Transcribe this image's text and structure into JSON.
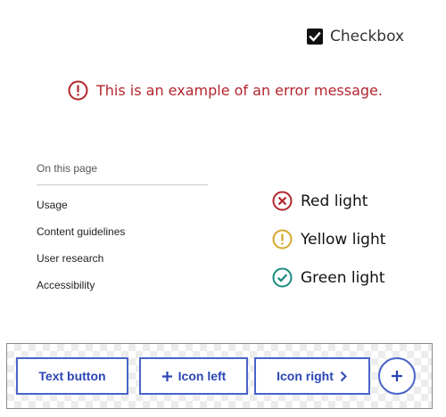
{
  "checkbox": {
    "label": "Checkbox",
    "checked": true,
    "icon": "checkmark-icon"
  },
  "error": {
    "message": "This is an example of an error message.",
    "icon": "error-circle-icon",
    "color": "#b3262e"
  },
  "toc": {
    "heading": "On this page",
    "items": [
      "Usage",
      "Content guidelines",
      "User research",
      "Accessibility"
    ]
  },
  "lights": [
    {
      "label": "Red light",
      "icon": "x-circle-icon",
      "color": "#b3262e"
    },
    {
      "label": "Yellow light",
      "icon": "exclamation-circle-icon",
      "color": "#d4a82a"
    },
    {
      "label": "Green light",
      "icon": "check-circle-icon",
      "color": "#178a7e"
    }
  ],
  "buttons": {
    "text_button": "Text button",
    "icon_left": "Icon left",
    "icon_right": "Icon right",
    "round_icon": "plus-icon",
    "accent": "#4a63c9"
  }
}
